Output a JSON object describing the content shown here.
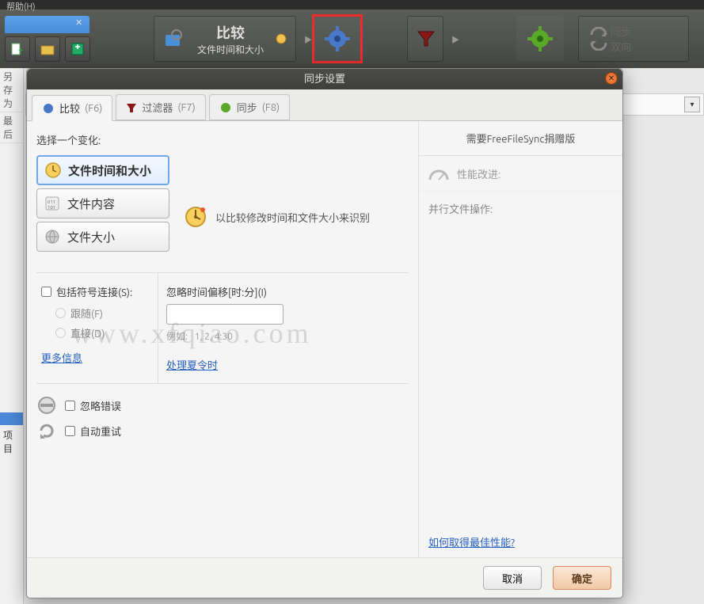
{
  "main": {
    "menu_help": "帮助(H)",
    "compare_label": "比较",
    "compare_sub": "文件时间和大小",
    "sync_label": "同步",
    "sync_sub": "双向"
  },
  "side": {
    "save_as": "另存为",
    "last": "最后",
    "item": "项目"
  },
  "dialog": {
    "title": "同步设置",
    "tabs": {
      "compare": "比较",
      "compare_key": "(F6)",
      "filter": "过滤器",
      "filter_key": "(F7)",
      "sync": "同步",
      "sync_key": "(F8)"
    },
    "select_label": "选择一个变化:",
    "options": {
      "time_size": "文件时间和大小",
      "content": "文件内容",
      "size": "文件大小"
    },
    "option_desc": "以比较修改时间和文件大小来识别",
    "symlink": {
      "label": "包括符号连接(S):",
      "follow": "跟随(F)",
      "direct": "直接(D)",
      "more": "更多信息"
    },
    "offset": {
      "label": "忽略时间偏移[时:分](I)",
      "example_prefix": "例如:",
      "example": "1, 2, 4:30",
      "dst": "处理夏令时"
    },
    "ignore_errors": "忽略错误",
    "auto_retry": "自动重试",
    "right": {
      "donate": "需要FreeFileSync捐赠版",
      "perf": "性能改进:",
      "parallel": "并行文件操作:",
      "perf_link": "如何取得最佳性能?"
    },
    "buttons": {
      "cancel": "取消",
      "ok": "确定"
    }
  },
  "watermark": "www.xfqiao.com"
}
